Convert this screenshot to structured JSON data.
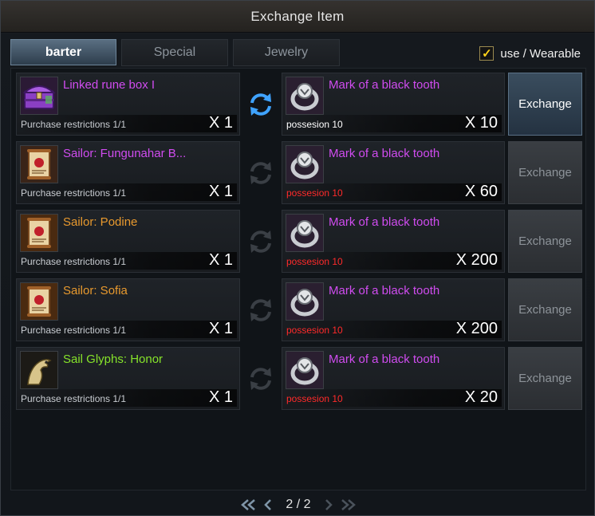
{
  "window": {
    "title": "Exchange Item"
  },
  "tabs": [
    {
      "label": "barter",
      "active": true
    },
    {
      "label": "Special",
      "active": false
    },
    {
      "label": "Jewelry",
      "active": false
    }
  ],
  "filter": {
    "checked": true,
    "label": "use / Wearable"
  },
  "rows": [
    {
      "give": {
        "icon": "purple-chest-icon",
        "name": "Linked rune box I",
        "name_color": "#d04cf0",
        "restriction": "Purchase restrictions 1/1",
        "qty": "X 1"
      },
      "get": {
        "icon": "black-tooth-ring-icon",
        "name": "Mark of a black tooth",
        "name_color": "#d04cf0",
        "possession": "possesion 10",
        "sufficient": true,
        "qty": "X 10"
      },
      "button": {
        "label": "Exchange",
        "enabled": true
      }
    },
    {
      "give": {
        "icon": "scroll-icon",
        "name": "Sailor: Fungunahar B...",
        "name_color": "#d04cf0",
        "restriction": "Purchase restrictions 1/1",
        "qty": "X 1"
      },
      "get": {
        "icon": "black-tooth-ring-icon",
        "name": "Mark of a black tooth",
        "name_color": "#d04cf0",
        "possession": "possesion 10",
        "sufficient": false,
        "qty": "X 60"
      },
      "button": {
        "label": "Exchange",
        "enabled": false
      }
    },
    {
      "give": {
        "icon": "scroll-icon",
        "name": "Sailor: Podine",
        "name_color": "#e8992e",
        "restriction": "Purchase restrictions 1/1",
        "qty": "X 1"
      },
      "get": {
        "icon": "black-tooth-ring-icon",
        "name": "Mark of a black tooth",
        "name_color": "#d04cf0",
        "possession": "possesion 10",
        "sufficient": false,
        "qty": "X 200"
      },
      "button": {
        "label": "Exchange",
        "enabled": false
      }
    },
    {
      "give": {
        "icon": "scroll-icon",
        "name": "Sailor: Sofia",
        "name_color": "#e8992e",
        "restriction": "Purchase restrictions 1/1",
        "qty": "X 1"
      },
      "get": {
        "icon": "black-tooth-ring-icon",
        "name": "Mark of a black tooth",
        "name_color": "#d04cf0",
        "possession": "possesion 10",
        "sufficient": false,
        "qty": "X 200"
      },
      "button": {
        "label": "Exchange",
        "enabled": false
      }
    },
    {
      "give": {
        "icon": "eagle-glyph-icon",
        "name": "Sail Glyphs: Honor",
        "name_color": "#86e32a",
        "restriction": "Purchase restrictions 1/1",
        "qty": "X 1"
      },
      "get": {
        "icon": "black-tooth-ring-icon",
        "name": "Mark of a black tooth",
        "name_color": "#d04cf0",
        "possession": "possesion 10",
        "sufficient": false,
        "qty": "X 20"
      },
      "button": {
        "label": "Exchange",
        "enabled": false
      }
    }
  ],
  "pagination": {
    "text": "2 / 2",
    "current": 2,
    "total": 2
  },
  "colors": {
    "accent_blue": "#3fa3ff",
    "rare_purple": "#d04cf0",
    "uncommon_orange": "#e8992e",
    "common_green": "#86e32a",
    "insufficient_red": "#ff2a2a"
  }
}
